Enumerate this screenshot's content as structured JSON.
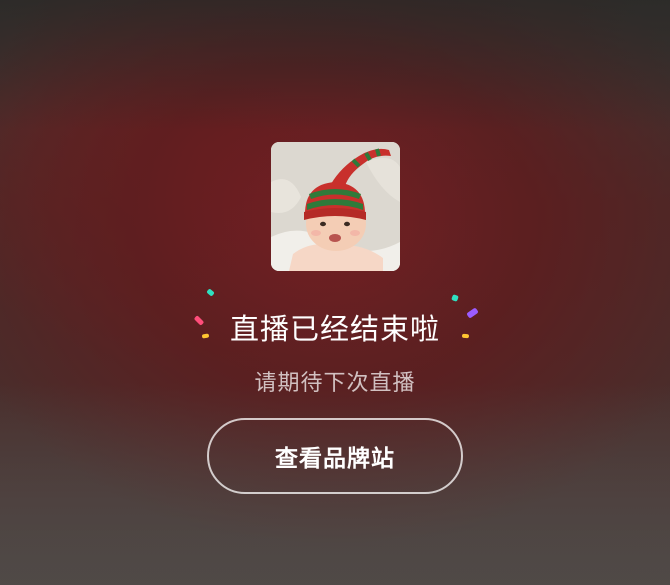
{
  "live_end": {
    "title": "直播已经结束啦",
    "subtitle": "请期待下次直播",
    "brand_button_label": "查看品牌站"
  },
  "colors": {
    "button_border": "#ffffff",
    "confetti_pink": "#ff4d7a",
    "confetti_teal": "#2fe0c0",
    "confetti_yellow": "#ffc531",
    "confetti_purple": "#9b5cff"
  },
  "icons": {
    "avatar": "baby-avatar-image",
    "confetti": "confetti-icon"
  }
}
